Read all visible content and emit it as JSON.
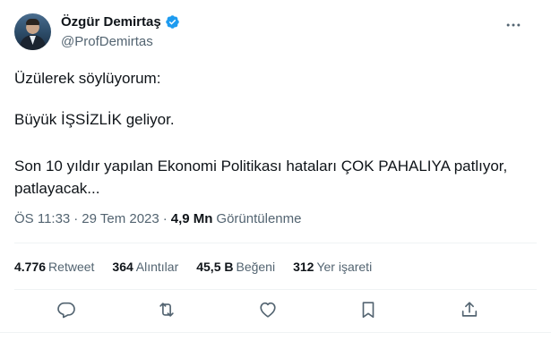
{
  "author": {
    "display_name": "Özgür Demirtaş",
    "handle": "@ProfDemirtas"
  },
  "tweet": {
    "lines": [
      "Üzülerek söylüyorum:",
      "Büyük İŞSİZLİK geliyor.",
      "Son 10 yıldır yapılan Ekonomi Politikası hataları ÇOK PAHALIYA patlıyor,",
      "patlayacak..."
    ],
    "time": "ÖS 11:33",
    "date": "29 Tem 2023",
    "views_count": "4,9 Mn",
    "views_label": "Görüntülenme"
  },
  "stats": {
    "retweets": {
      "count": "4.776",
      "label": "Retweet"
    },
    "quotes": {
      "count": "364",
      "label": "Alıntılar"
    },
    "likes": {
      "count": "45,5 B",
      "label": "Beğeni"
    },
    "bookmarks": {
      "count": "312",
      "label": "Yer işareti"
    }
  },
  "icons": {
    "verified": "verified-badge-icon",
    "more": "more-options-icon",
    "reply": "reply-icon",
    "retweet": "retweet-icon",
    "like": "like-icon",
    "bookmark": "bookmark-icon",
    "share": "share-icon"
  },
  "colors": {
    "accent": "#1d9bf0",
    "text": "#0f1419",
    "secondary": "#536471",
    "divider": "#eff3f4"
  }
}
